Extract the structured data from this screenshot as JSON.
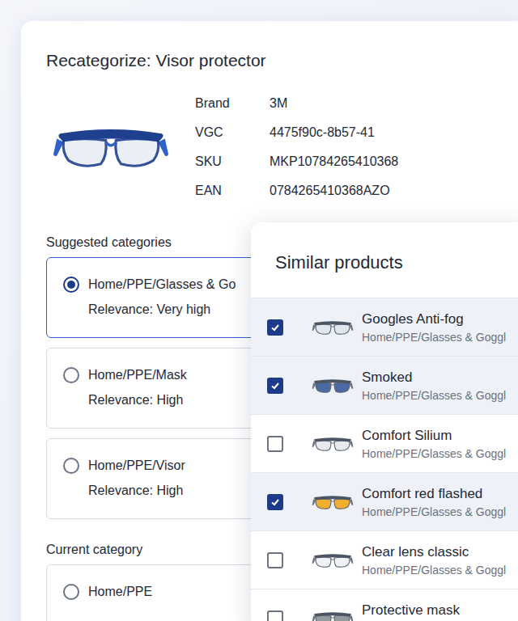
{
  "page": {
    "title": "Recategorize: Visor protector"
  },
  "product": {
    "fields": [
      {
        "label": "Brand",
        "value": "3M"
      },
      {
        "label": "VGC",
        "value": "4475f90c-8b57-41"
      },
      {
        "label": "SKU",
        "value": "MKP10784265410368"
      },
      {
        "label": "EAN",
        "value": "0784265410368AZO"
      }
    ]
  },
  "suggested": {
    "label": "Suggested categories",
    "items": [
      {
        "path": "Home/PPE/Glasses & Go",
        "relevance": "Relevance: Very high",
        "selected": true
      },
      {
        "path": "Home/PPE/Mask",
        "relevance": "Relevance: High",
        "selected": false
      },
      {
        "path": "Home/PPE/Visor",
        "relevance": "Relevance: High",
        "selected": false
      }
    ]
  },
  "current": {
    "label": "Current category",
    "items": [
      {
        "path": "Home/PPE",
        "selected": false
      }
    ]
  },
  "similar": {
    "title": "Similar products",
    "items": [
      {
        "name": "Googles Anti-fog",
        "category": "Home/PPE/Glasses & Goggl",
        "checked": true,
        "color": "#dfe6ee"
      },
      {
        "name": "Smoked",
        "category": "Home/PPE/Glasses & Goggl",
        "checked": true,
        "color": "#3b5b9a"
      },
      {
        "name": "Comfort Silium",
        "category": "Home/PPE/Glasses & Goggl",
        "checked": false,
        "color": "#e5e7eb"
      },
      {
        "name": "Comfort red flashed",
        "category": "Home/PPE/Glasses & Goggl",
        "checked": true,
        "color": "#f2a81d"
      },
      {
        "name": "Clear lens classic",
        "category": "Home/PPE/Glasses & Goggl",
        "checked": false,
        "color": "#eef1f4"
      },
      {
        "name": "Protective mask",
        "category": "",
        "checked": false,
        "color": "#8a8f96"
      }
    ]
  }
}
